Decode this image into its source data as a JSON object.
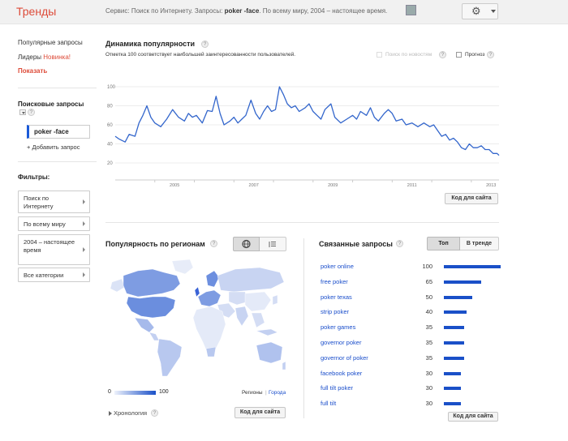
{
  "header": {
    "logo": "Тренды",
    "crumb_pre": "Сервис: Поиск по Интернету. Запросы: ",
    "crumb_query": "poker -face",
    "crumb_post": ". По всему миру, 2004 – настоящее время.",
    "share_icon": "share-icon",
    "settings_icon": "gear-icon"
  },
  "sidebar": {
    "popular": "Популярные запросы",
    "leaders": "Лидеры",
    "leaders_new": "Новинка!",
    "show": "Показать",
    "queries_head": "Поисковые запросы",
    "query": "poker -face",
    "add_query": "+ Добавить запрос",
    "filters_head": "Фильтры:",
    "filters": [
      "Поиск по Интернету",
      "По всему миру",
      "2004 – настоящее время",
      "Все категории"
    ]
  },
  "interest": {
    "title": "Динамика популярности",
    "note": "Отметка 100 соответствует наибольшей заинтересованности пользователей.",
    "news_label": "Поиск по новостям",
    "forecast_label": "Прогноз",
    "embed": "Код для сайта"
  },
  "chart_data": {
    "type": "line",
    "title": "",
    "xlabel": "",
    "ylabel": "",
    "yticks": [
      "100",
      "80",
      "60",
      "40",
      "20"
    ],
    "ylim": [
      20,
      100
    ],
    "xticks": [
      "2005",
      "2007",
      "2009",
      "2011",
      "2013"
    ],
    "xlim": [
      2004,
      2013.7
    ],
    "grid": true,
    "color": "#3366cc",
    "series": [
      {
        "values": [
          [
            2004.0,
            48
          ],
          [
            2004.1,
            45
          ],
          [
            2004.25,
            42
          ],
          [
            2004.35,
            50
          ],
          [
            2004.5,
            48
          ],
          [
            2004.6,
            62
          ],
          [
            2004.7,
            70
          ],
          [
            2004.8,
            80
          ],
          [
            2004.9,
            68
          ],
          [
            2005.0,
            62
          ],
          [
            2005.15,
            58
          ],
          [
            2005.3,
            66
          ],
          [
            2005.45,
            76
          ],
          [
            2005.6,
            68
          ],
          [
            2005.75,
            64
          ],
          [
            2005.85,
            72
          ],
          [
            2005.95,
            68
          ],
          [
            2006.05,
            70
          ],
          [
            2006.2,
            62
          ],
          [
            2006.33,
            75
          ],
          [
            2006.45,
            74
          ],
          [
            2006.55,
            90
          ],
          [
            2006.65,
            72
          ],
          [
            2006.75,
            60
          ],
          [
            2006.9,
            64
          ],
          [
            2007.0,
            68
          ],
          [
            2007.1,
            62
          ],
          [
            2007.2,
            66
          ],
          [
            2007.3,
            70
          ],
          [
            2007.43,
            86
          ],
          [
            2007.55,
            72
          ],
          [
            2007.65,
            66
          ],
          [
            2007.75,
            74
          ],
          [
            2007.85,
            80
          ],
          [
            2007.95,
            74
          ],
          [
            2008.05,
            76
          ],
          [
            2008.15,
            100
          ],
          [
            2008.25,
            92
          ],
          [
            2008.35,
            82
          ],
          [
            2008.45,
            78
          ],
          [
            2008.55,
            80
          ],
          [
            2008.65,
            74
          ],
          [
            2008.8,
            78
          ],
          [
            2008.9,
            82
          ],
          [
            2009.0,
            74
          ],
          [
            2009.1,
            70
          ],
          [
            2009.2,
            66
          ],
          [
            2009.3,
            76
          ],
          [
            2009.45,
            82
          ],
          [
            2009.55,
            68
          ],
          [
            2009.7,
            62
          ],
          [
            2009.85,
            66
          ],
          [
            2010.0,
            70
          ],
          [
            2010.1,
            66
          ],
          [
            2010.2,
            74
          ],
          [
            2010.35,
            70
          ],
          [
            2010.45,
            78
          ],
          [
            2010.55,
            68
          ],
          [
            2010.65,
            64
          ],
          [
            2010.8,
            72
          ],
          [
            2010.9,
            76
          ],
          [
            2011.0,
            72
          ],
          [
            2011.1,
            64
          ],
          [
            2011.25,
            66
          ],
          [
            2011.35,
            60
          ],
          [
            2011.5,
            62
          ],
          [
            2011.65,
            58
          ],
          [
            2011.8,
            62
          ],
          [
            2011.95,
            58
          ],
          [
            2012.05,
            60
          ],
          [
            2012.15,
            54
          ],
          [
            2012.25,
            48
          ],
          [
            2012.35,
            50
          ],
          [
            2012.45,
            44
          ],
          [
            2012.55,
            46
          ],
          [
            2012.65,
            42
          ],
          [
            2012.75,
            36
          ],
          [
            2012.85,
            34
          ],
          [
            2012.95,
            40
          ],
          [
            2013.05,
            36
          ],
          [
            2013.15,
            36
          ],
          [
            2013.25,
            38
          ],
          [
            2013.35,
            34
          ],
          [
            2013.45,
            34
          ],
          [
            2013.55,
            30
          ],
          [
            2013.65,
            30
          ],
          [
            2013.7,
            28
          ]
        ]
      }
    ]
  },
  "regions": {
    "title": "Популярность по регионам",
    "map_icon": "globe-icon",
    "list_icon": "list-icon",
    "legend_min": "0",
    "legend_max": "100",
    "regions_label": "Регионы",
    "sep": "|",
    "cities_link": "Города",
    "chronology": "Хронология",
    "embed": "Код для сайта"
  },
  "related": {
    "title": "Связанные запросы",
    "tab_top": "Топ",
    "tab_trend": "В тренде",
    "embed": "Код для сайта",
    "items": [
      {
        "term": "poker online",
        "value": 100
      },
      {
        "term": "free poker",
        "value": 65
      },
      {
        "term": "poker texas",
        "value": 50
      },
      {
        "term": "strip poker",
        "value": 40
      },
      {
        "term": "poker games",
        "value": 35
      },
      {
        "term": "governor poker",
        "value": 35
      },
      {
        "term": "governor of poker",
        "value": 35
      },
      {
        "term": "facebook poker",
        "value": 30
      },
      {
        "term": "full tilt poker",
        "value": 30
      },
      {
        "term": "full tilt",
        "value": 30
      }
    ]
  }
}
